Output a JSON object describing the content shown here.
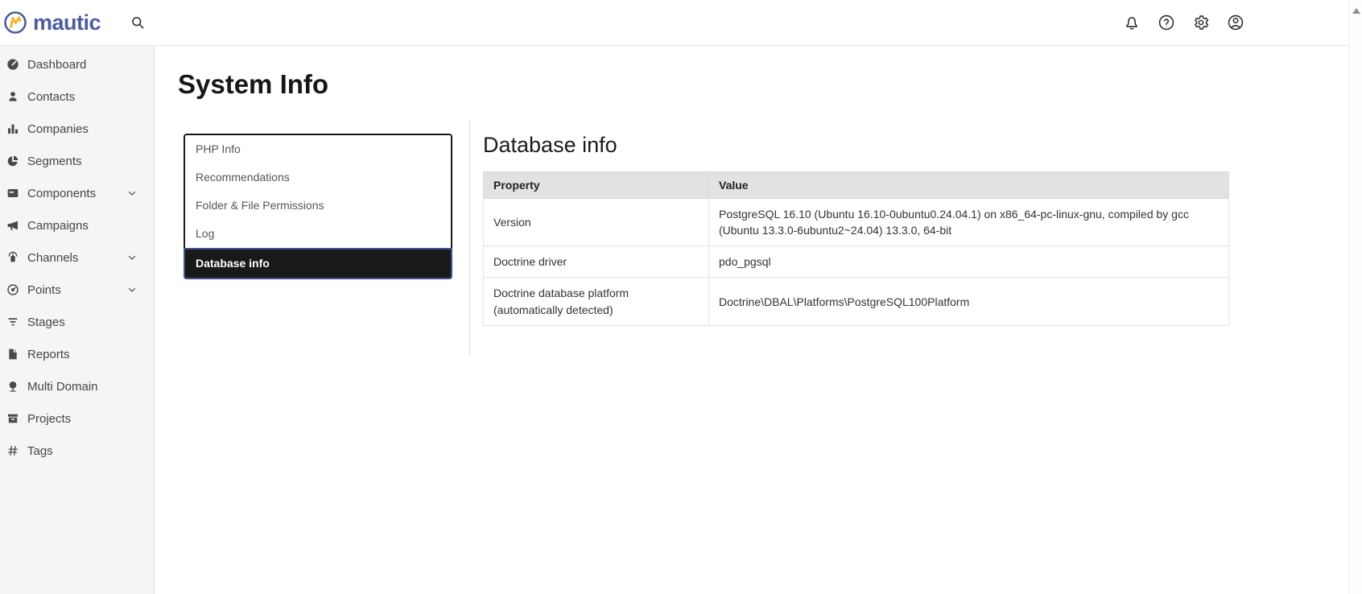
{
  "brand": {
    "name": "mautic"
  },
  "topbar": {
    "icons": [
      "notifications",
      "help",
      "settings",
      "account"
    ]
  },
  "sidebar": {
    "items": [
      {
        "label": "Dashboard",
        "icon": "dashboard-icon",
        "has_submenu": false
      },
      {
        "label": "Contacts",
        "icon": "contacts-icon",
        "has_submenu": false
      },
      {
        "label": "Companies",
        "icon": "companies-icon",
        "has_submenu": false
      },
      {
        "label": "Segments",
        "icon": "segments-icon",
        "has_submenu": false
      },
      {
        "label": "Components",
        "icon": "components-icon",
        "has_submenu": true
      },
      {
        "label": "Campaigns",
        "icon": "campaigns-icon",
        "has_submenu": false
      },
      {
        "label": "Channels",
        "icon": "channels-icon",
        "has_submenu": true
      },
      {
        "label": "Points",
        "icon": "points-icon",
        "has_submenu": true
      },
      {
        "label": "Stages",
        "icon": "stages-icon",
        "has_submenu": false
      },
      {
        "label": "Reports",
        "icon": "reports-icon",
        "has_submenu": false
      },
      {
        "label": "Multi Domain",
        "icon": "multi-domain-icon",
        "has_submenu": false
      },
      {
        "label": "Projects",
        "icon": "projects-icon",
        "has_submenu": false
      },
      {
        "label": "Tags",
        "icon": "tags-icon",
        "has_submenu": false
      }
    ]
  },
  "page": {
    "title": "System Info"
  },
  "tabs": {
    "items": [
      {
        "label": "PHP Info",
        "active": false
      },
      {
        "label": "Recommendations",
        "active": false
      },
      {
        "label": "Folder & File Permissions",
        "active": false
      },
      {
        "label": "Log",
        "active": false
      },
      {
        "label": "Database info",
        "active": true
      }
    ]
  },
  "panel": {
    "heading": "Database info",
    "table": {
      "columns": [
        "Property",
        "Value"
      ],
      "rows": [
        {
          "property": "Version",
          "value": "PostgreSQL 16.10 (Ubuntu 16.10-0ubuntu0.24.04.1) on x86_64-pc-linux-gnu, compiled by gcc (Ubuntu 13.3.0-6ubuntu2~24.04) 13.3.0, 64-bit"
        },
        {
          "property": "Doctrine driver",
          "value": "pdo_pgsql"
        },
        {
          "property": "Doctrine database platform (automatically detected)",
          "value": "Doctrine\\DBAL\\Platforms\\PostgreSQL100Platform"
        }
      ]
    }
  },
  "colors": {
    "brand_primary": "#4e5d9d",
    "brand_accent": "#f9b13a",
    "sidebar_bg": "#f5f5f6",
    "active_tab_bg": "#191919",
    "active_tab_border": "#42528a",
    "table_header_bg": "#e2e2e2"
  }
}
